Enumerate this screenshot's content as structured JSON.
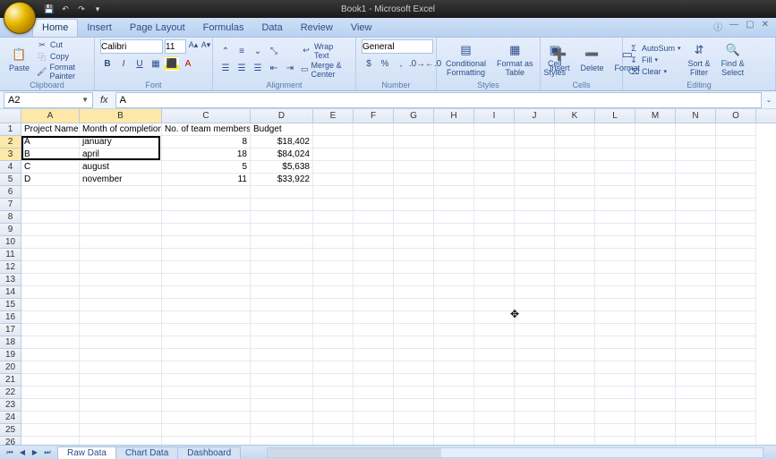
{
  "title": "Book1 - Microsoft Excel",
  "qat": {
    "save": "💾",
    "undo": "↶",
    "redo": "↷",
    "more": "▾"
  },
  "tabs": [
    "Home",
    "Insert",
    "Page Layout",
    "Formulas",
    "Data",
    "Review",
    "View"
  ],
  "active_tab": "Home",
  "clipboard": {
    "paste": "Paste",
    "cut": "Cut",
    "copy": "Copy",
    "painter": "Format Painter",
    "label": "Clipboard"
  },
  "font": {
    "name": "Calibri",
    "size": "11",
    "label": "Font"
  },
  "alignment": {
    "wrap": "Wrap Text",
    "merge": "Merge & Center",
    "label": "Alignment"
  },
  "number": {
    "format": "General",
    "label": "Number"
  },
  "styles": {
    "cond": "Conditional\nFormatting",
    "table": "Format as\nTable",
    "cell": "Cell\nStyles",
    "label": "Styles"
  },
  "cells": {
    "insert": "Insert",
    "delete": "Delete",
    "format": "Format",
    "label": "Cells"
  },
  "editing": {
    "autosum": "AutoSum",
    "fill": "Fill",
    "clear": "Clear",
    "sort": "Sort &\nFilter",
    "find": "Find &\nSelect",
    "label": "Editing"
  },
  "namebox": "A2",
  "formula": "A",
  "columns": [
    "A",
    "B",
    "C",
    "D",
    "E",
    "F",
    "G",
    "H",
    "I",
    "J",
    "K",
    "L",
    "M",
    "N",
    "O"
  ],
  "chart_data": {
    "type": "table",
    "columns": [
      "Project Name",
      "Month of completion",
      "No. of team members",
      "Budget"
    ],
    "rows": [
      [
        "A",
        "january",
        "8",
        "$18,402"
      ],
      [
        "B",
        "april",
        "18",
        "$84,024"
      ],
      [
        "C",
        "august",
        "5",
        "$5,638"
      ],
      [
        "D",
        "november",
        "11",
        "$33,922"
      ]
    ]
  },
  "selection": {
    "ref": "A2:B3"
  },
  "sheets": [
    "Raw Data",
    "Chart Data",
    "Dashboard"
  ],
  "active_sheet": "Raw Data"
}
